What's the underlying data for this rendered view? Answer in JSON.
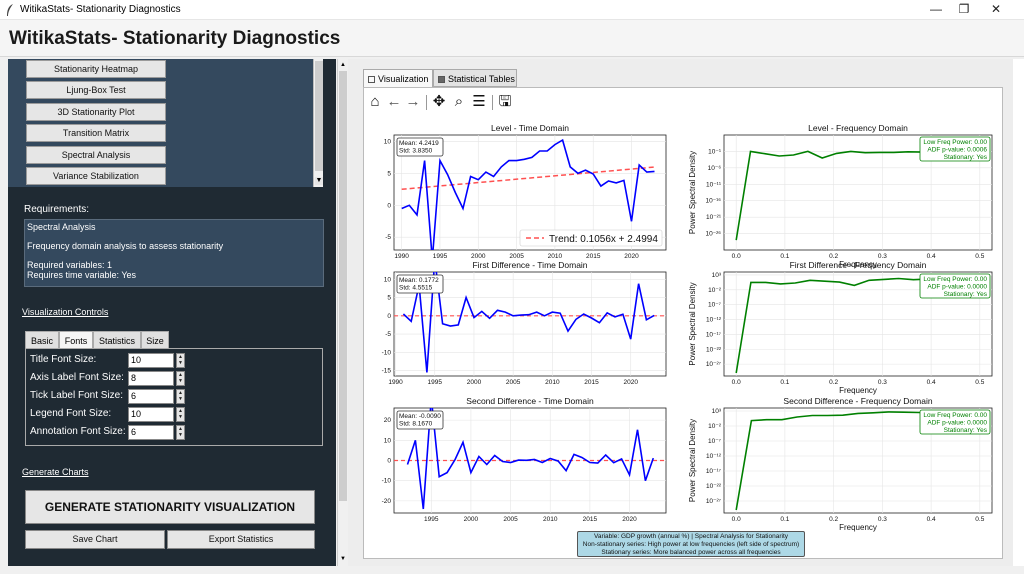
{
  "window": {
    "title": "WitikaStats- Stationarity Diagnostics"
  },
  "app": {
    "title": "WitikaStats- Stationarity Diagnostics"
  },
  "sidebar": {
    "buttons": [
      "Stationarity Heatmap",
      "Ljung-Box Test",
      "3D Stationarity Plot",
      "Transition Matrix",
      "Spectral Analysis",
      "Variance Stabilization"
    ],
    "requirements_label": "Requirements:",
    "requirements": {
      "line1": "Spectral Analysis",
      "line2": "Frequency domain analysis to assess stationarity",
      "line3": "Required variables: 1",
      "line4": "Requires time variable: Yes"
    },
    "vis_controls_label": "Visualization Controls",
    "tabs": [
      "Basic",
      "Fonts",
      "Statistics",
      "Size"
    ],
    "active_tab": "Fonts",
    "font_settings": [
      {
        "label": "Title Font Size:",
        "value": "10"
      },
      {
        "label": "Axis Label Font Size:",
        "value": "8"
      },
      {
        "label": "Tick Label Font Size:",
        "value": "6"
      },
      {
        "label": "Legend Font Size:",
        "value": "10"
      },
      {
        "label": "Annotation Font Size:",
        "value": "6"
      }
    ],
    "generate_label": "Generate Charts",
    "generate_button": "GENERATE STATIONARITY VISUALIZATION",
    "save_button": "Save Chart",
    "export_button": "Export Statistics"
  },
  "main": {
    "tabs": [
      "Visualization",
      "Statistical Tables"
    ],
    "active_tab": "Visualization",
    "toolbar_icons": [
      "home-icon",
      "back-icon",
      "forward-icon",
      "pan-icon",
      "zoom-icon",
      "configure-icon",
      "save-icon"
    ],
    "footer": {
      "line1": "Variable: GDP growth (annual %) | Spectral Analysis for Stationarity",
      "line2": "Non-stationary series: High power at low frequencies (left side of spectrum)",
      "line3": "Stationary series: More balanced power across all frequencies"
    }
  },
  "chart_data": [
    {
      "type": "line",
      "title": "Level - Time Domain",
      "x": [
        1990,
        1991,
        1992,
        1993,
        1994,
        1995,
        1996,
        1997,
        1998,
        1999,
        2000,
        2001,
        2002,
        2003,
        2004,
        2005,
        2006,
        2007,
        2008,
        2009,
        2010,
        2011,
        2012,
        2013,
        2014,
        2015,
        2016,
        2017,
        2018,
        2019,
        2020,
        2021,
        2022,
        2023
      ],
      "series": [
        {
          "color": "#0000ff",
          "values": [
            -0.5,
            0,
            -1.5,
            7,
            -8.5,
            7,
            4.8,
            2,
            -0.5,
            4.5,
            4,
            5.2,
            4.5,
            6,
            7,
            7,
            7.2,
            7.5,
            8.5,
            8.5,
            9.5,
            10.2,
            6,
            5,
            5.5,
            4.9,
            3,
            3.8,
            3.5,
            3.9,
            -2.5,
            6.3,
            5.2,
            5.3
          ]
        }
      ],
      "trend_label": "Trend: 0.1056x + 2.4994",
      "trend": {
        "slope": 0.1056,
        "intercept": 2.4994,
        "color": "#ff5050"
      },
      "stats": [
        "Mean: 4.2419",
        "Std: 3.8350"
      ],
      "xticks": [
        "1990",
        "1995",
        "2000",
        "2005",
        "2010",
        "2015",
        "2020"
      ],
      "yticks": [
        "-5",
        "0",
        "5",
        "10"
      ],
      "ylim": [
        -7,
        11
      ]
    },
    {
      "type": "line",
      "title": "Level - Frequency Domain",
      "ylabel": "Power Spectral Density",
      "xlabel": "Frequency",
      "yscale": "log",
      "x": [
        0,
        0.0294,
        0.0588,
        0.0882,
        0.1176,
        0.1471,
        0.1765,
        0.2059,
        0.2353,
        0.2647,
        0.2941,
        0.3235,
        0.3529,
        0.3824,
        0.4118
      ],
      "series": [
        {
          "color": "#008000",
          "values": [
            -28,
            -1,
            -1.7,
            -2.4,
            -2.1,
            -1,
            -3,
            -1.6,
            -1,
            -1.4,
            -1.3,
            -1.3,
            -1.1,
            -1.2,
            -1.2
          ]
        }
      ],
      "stats": [
        "Low Freq Power: 0.00",
        "ADF p-value: 0.0006",
        "Stationary: Yes"
      ],
      "xticks": [
        "0.0",
        "0.1",
        "0.2",
        "0.3",
        "0.4",
        "0.5"
      ],
      "yticks": [
        "10⁻¹",
        "10⁻⁶",
        "10⁻¹¹",
        "10⁻¹⁶",
        "10⁻²¹",
        "10⁻²⁶"
      ]
    },
    {
      "type": "line",
      "title": "First Difference - Time Domain",
      "x": [
        1991,
        1992,
        1993,
        1994,
        1995,
        1996,
        1997,
        1998,
        1999,
        2000,
        2001,
        2002,
        2003,
        2004,
        2005,
        2006,
        2007,
        2008,
        2009,
        2010,
        2011,
        2012,
        2013,
        2014,
        2015,
        2016,
        2017,
        2018,
        2019,
        2020,
        2021,
        2022,
        2023
      ],
      "series": [
        {
          "color": "#0000ff",
          "values": [
            0.5,
            -1.5,
            8.5,
            -15.5,
            15.5,
            -2.2,
            -2.8,
            -2.5,
            5,
            -0.5,
            1.2,
            -0.7,
            1.5,
            1,
            0,
            0.2,
            0.3,
            1,
            0,
            1,
            0.7,
            -4.2,
            -1,
            0.5,
            -0.6,
            -1.9,
            0.8,
            -0.3,
            0.4,
            -6.4,
            8.8,
            -1.1,
            0.1
          ]
        }
      ],
      "trend": {
        "zero": true,
        "color": "#ff5050"
      },
      "stats": [
        "Mean: 0.1772",
        "Std: 4.5515"
      ],
      "xticks": [
        "1990",
        "1995",
        "2000",
        "2005",
        "2010",
        "2015",
        "2020"
      ],
      "yticks": [
        "-15",
        "-10",
        "-5",
        "0",
        "5",
        "10"
      ],
      "ylim": [
        -16.5,
        12
      ]
    },
    {
      "type": "line",
      "title": "First Difference - Frequency Domain",
      "ylabel": "Power Spectral Density",
      "xlabel": "Frequency",
      "yscale": "log",
      "x": [
        0,
        0.0303,
        0.0606,
        0.0909,
        0.1212,
        0.1515,
        0.1818,
        0.2121,
        0.2424,
        0.2727,
        0.303,
        0.3333,
        0.3636,
        0.3939,
        0.4242,
        0.4545,
        0.4848
      ],
      "series": [
        {
          "color": "#008000",
          "values": [
            -30,
            0.5,
            0.5,
            0,
            0.3,
            1.2,
            0.9,
            0.6,
            -0.5,
            1.2,
            1.5,
            1.8,
            1.4,
            1.6,
            1.5,
            1.3,
            1.5
          ]
        }
      ],
      "stats": [
        "Low Freq Power: 0.00",
        "ADF p-value: 0.0000",
        "Stationary: Yes"
      ],
      "xticks": [
        "0.0",
        "0.1",
        "0.2",
        "0.3",
        "0.4",
        "0.5"
      ],
      "yticks": [
        "10³",
        "10⁻²",
        "10⁻⁷",
        "10⁻¹²",
        "10⁻¹⁷",
        "10⁻²²",
        "10⁻²⁷"
      ]
    },
    {
      "type": "line",
      "title": "Second Difference - Time Domain",
      "x": [
        1992,
        1993,
        1994,
        1995,
        1996,
        1997,
        1998,
        1999,
        2000,
        2001,
        2002,
        2003,
        2004,
        2005,
        2006,
        2007,
        2008,
        2009,
        2010,
        2011,
        2012,
        2013,
        2014,
        2015,
        2016,
        2017,
        2018,
        2019,
        2020,
        2021,
        2022,
        2023
      ],
      "series": [
        {
          "color": "#0000ff",
          "values": [
            -2,
            10,
            -24,
            31,
            -8,
            -6,
            0.5,
            9,
            -6,
            2,
            -2,
            2.5,
            -0.5,
            -1,
            0.2,
            0.1,
            0.5,
            -1,
            1,
            -0.3,
            -5,
            3,
            1.5,
            -1,
            -1.3,
            2.7,
            -1.1,
            0.8,
            -7.1,
            15.2,
            -10,
            1.2
          ]
        }
      ],
      "trend": {
        "zero": true,
        "color": "#ff5050"
      },
      "stats": [
        "Mean: -0.0090",
        "Std: 8.1670"
      ],
      "xticks": [
        "1995",
        "2000",
        "2005",
        "2010",
        "2015",
        "2020"
      ],
      "yticks": [
        "-20",
        "-10",
        "0",
        "10",
        "20"
      ],
      "ylim": [
        -26,
        26
      ]
    },
    {
      "type": "line",
      "title": "Second Difference - Frequency Domain",
      "ylabel": "Power Spectral Density",
      "xlabel": "Frequency",
      "yscale": "log",
      "x": [
        0,
        0.03125,
        0.0625,
        0.09375,
        0.125,
        0.15625,
        0.1875,
        0.21875,
        0.25,
        0.28125,
        0.3125,
        0.34375,
        0.375,
        0.40625,
        0.4375,
        0.46875,
        0.5
      ],
      "series": [
        {
          "color": "#008000",
          "values": [
            -30,
            -0.2,
            0.1,
            0.1,
            1,
            1.5,
            1.5,
            1.6,
            2.2,
            2.4,
            2.7,
            2.6,
            2.5,
            2.3,
            2.5,
            2.3,
            2.6
          ]
        }
      ],
      "stats": [
        "Low Freq Power: 0.00",
        "ADF p-value: 0.0000",
        "Stationary: Yes"
      ],
      "xticks": [
        "0.0",
        "0.1",
        "0.2",
        "0.3",
        "0.4",
        "0.5"
      ],
      "yticks": [
        "10³",
        "10⁻²",
        "10⁻⁷",
        "10⁻¹²",
        "10⁻¹⁷",
        "10⁻²²",
        "10⁻²⁷"
      ]
    }
  ]
}
